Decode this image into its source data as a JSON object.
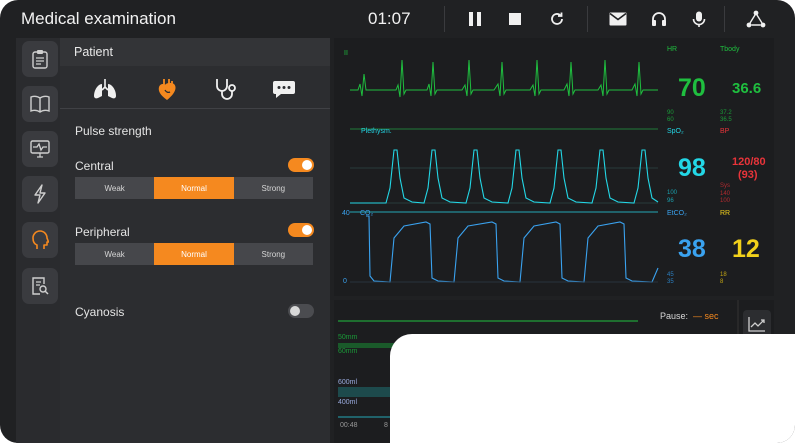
{
  "app": {
    "title": "Medical examination",
    "timer": "01:07"
  },
  "toolbar": {
    "icons": [
      "pause-icon",
      "stop-icon",
      "restart-icon",
      "mail-icon",
      "headphones-icon",
      "microphone-icon",
      "network-icon"
    ]
  },
  "rail": {
    "icons": [
      "clipboard-icon",
      "book-icon",
      "monitor-icon",
      "lightning-icon",
      "head-icon",
      "report-search-icon"
    ]
  },
  "patient": {
    "title": "Patient",
    "tabs": [
      "lungs-icon",
      "heart-icon",
      "stethoscope-icon",
      "speech-icon"
    ],
    "pulse_strength": "Pulse strength",
    "central": {
      "label": "Central",
      "options": [
        "Weak",
        "Normal",
        "Strong"
      ],
      "selected": "Normal",
      "enabled": true
    },
    "peripheral": {
      "label": "Peripheral",
      "options": [
        "Weak",
        "Normal",
        "Strong"
      ],
      "selected": "Normal",
      "enabled": true
    },
    "cyanosis": {
      "label": "Cyanosis",
      "enabled": false
    }
  },
  "monitor": {
    "ecg_lead": "II",
    "hr": {
      "label": "HR",
      "value": "70",
      "hi": "90",
      "lo": "60"
    },
    "tbody": {
      "label": "Tbody",
      "value": "36.6",
      "hi": "37.2",
      "lo": "36.5"
    },
    "pleth_label": "Plethysm.",
    "spo2": {
      "label": "SpO₂",
      "value": "98",
      "hi": "100",
      "lo": "96"
    },
    "bp": {
      "label": "BP",
      "value": "120/80",
      "mean": "(93)",
      "sys": "Sys",
      "sys_hi": "140",
      "sys_lo": "100"
    },
    "co2_label": "CO₂",
    "co2_top": "40",
    "co2_bottom": "0",
    "etco2": {
      "label": "EtCO₂",
      "value": "38",
      "hi": "45",
      "lo": "35"
    },
    "rr": {
      "label": "RR",
      "value": "12",
      "hi": "18",
      "lo": "8"
    }
  },
  "bottom": {
    "pause_label": "Pause:",
    "pause_value": "— sec",
    "labels": [
      "50mm",
      "60mm",
      "600ml",
      "400ml",
      "00:48",
      "8"
    ],
    "chart_icon": "line-chart-icon"
  },
  "colors": {
    "accent": "#f5891f",
    "green": "#1fbf3f",
    "cyan": "#23d7e6",
    "red": "#e8343a",
    "yellow": "#f2d11b",
    "blue": "#3aa2ef"
  }
}
